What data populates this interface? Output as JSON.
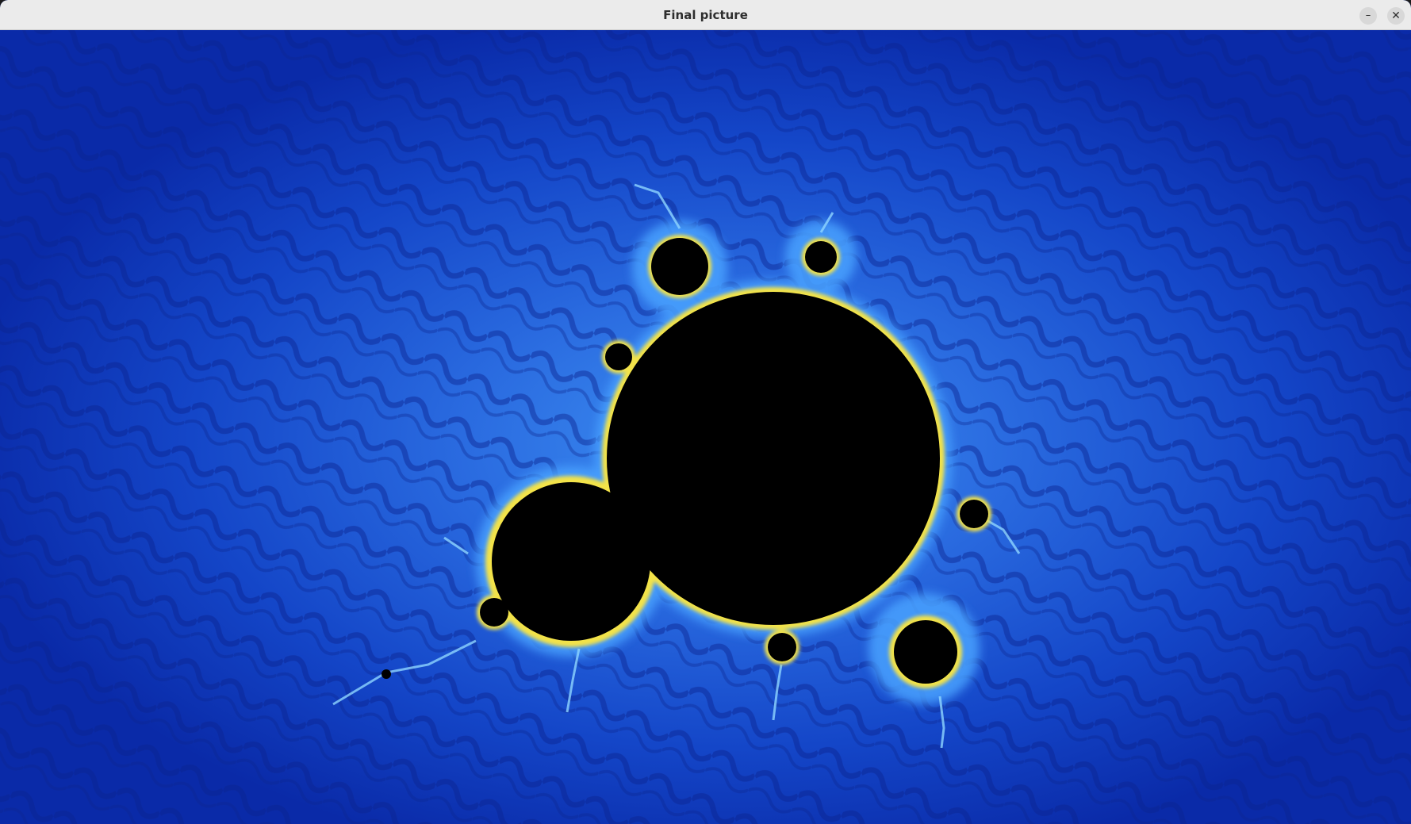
{
  "window": {
    "title": "Final picture",
    "minimize_glyph": "–",
    "close_glyph": "✕"
  },
  "image": {
    "subject": "mandelbrot-fractal",
    "colors": {
      "background_dark": "#0a2aa8",
      "background_mid": "#1448d0",
      "glow_light": "#3a8cf0",
      "edge_cyan": "#7fe0ff",
      "edge_yellow": "#f3e34a",
      "set_interior": "#000000",
      "titlebar": "#ebebeb"
    }
  }
}
